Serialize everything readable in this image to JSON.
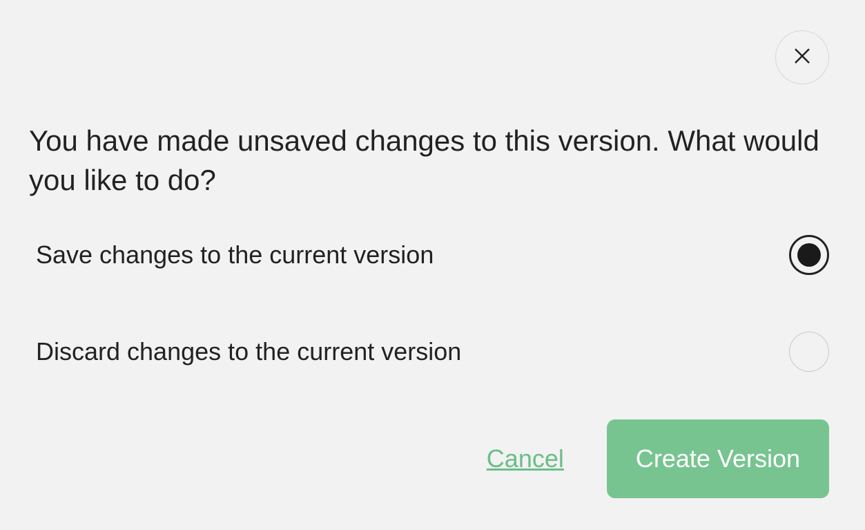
{
  "dialog": {
    "title": "You have made unsaved changes to this version. What would you like to do?",
    "options": [
      {
        "label": "Save changes to the current version",
        "selected": true
      },
      {
        "label": "Discard changes to the current version",
        "selected": false
      }
    ],
    "cancel_label": "Cancel",
    "primary_label": "Create Version"
  }
}
